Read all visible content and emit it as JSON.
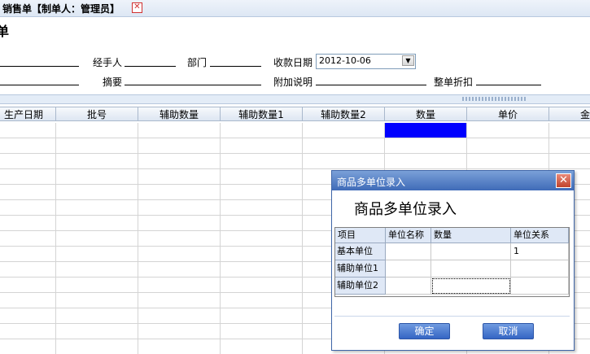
{
  "tab": {
    "title": "销售单【制单人：管理员】",
    "close_icon": "close-icon"
  },
  "page": {
    "title_fragment": "单"
  },
  "form": {
    "handler_label": "经手人",
    "dept_label": "部门",
    "collect_date_label": "收款日期",
    "collect_date_value": "2012-10-06",
    "summary_label": "摘要",
    "extra_note_label": "附加说明",
    "discount_label": "整单折扣"
  },
  "grid": {
    "columns": [
      "生产日期",
      "批号",
      "辅助数量",
      "辅助数量1",
      "辅助数量2",
      "数量",
      "单价",
      "金"
    ],
    "selected_color": "#0000ff"
  },
  "dialog": {
    "title": "商品多单位录入",
    "heading": "商品多单位录入",
    "columns": [
      "项目",
      "单位名称",
      "数量",
      "单位关系"
    ],
    "rows": [
      {
        "item": "基本单位",
        "unit_name": "",
        "qty": "",
        "relation": "1"
      },
      {
        "item": "辅助单位1",
        "unit_name": "",
        "qty": "",
        "relation": ""
      },
      {
        "item": "辅助单位2",
        "unit_name": "",
        "qty": "",
        "relation": ""
      }
    ],
    "ok_label": "确定",
    "cancel_label": "取消"
  },
  "colors": {
    "dialog_title": "#3f6bb8",
    "button": "#3566c4",
    "close": "#c0432c"
  }
}
